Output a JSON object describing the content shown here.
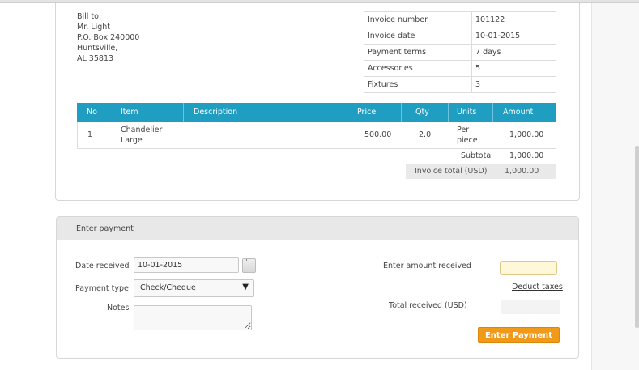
{
  "bill_to": {
    "heading": "Bill to:",
    "name": "Mr. Light",
    "address_line1": "P.O. Box 240000",
    "city": "Huntsville,",
    "state_zip": "AL 35813"
  },
  "invoice_meta": [
    {
      "label": "Invoice number",
      "value": "101122"
    },
    {
      "label": "Invoice date",
      "value": "10-01-2015"
    },
    {
      "label": "Payment terms",
      "value": "7 days"
    },
    {
      "label": "Accessories",
      "value": "5"
    },
    {
      "label": "Fixtures",
      "value": "3"
    }
  ],
  "items_table": {
    "headers": {
      "no": "No",
      "item": "Item",
      "description": "Description",
      "price": "Price",
      "qty": "Qty",
      "units": "Units",
      "amount": "Amount"
    },
    "rows": [
      {
        "no": "1",
        "item_line1": "Chandelier",
        "item_line2": "Large",
        "description": "",
        "price": "500.00",
        "qty": "2.0",
        "units_line1": "Per",
        "units_line2": "piece",
        "amount": "1,000.00"
      }
    ],
    "subtotal_label": "Subtotal",
    "subtotal_value": "1,000.00",
    "total_label": "Invoice total (USD)",
    "total_value": "1,000.00"
  },
  "payment": {
    "section_title": "Enter payment",
    "date_label": "Date received",
    "date_value": "10-01-2015",
    "type_label": "Payment type",
    "type_value": "Check/Cheque",
    "notes_label": "Notes",
    "notes_value": "",
    "amount_label": "Enter amount received",
    "amount_value": "",
    "deduct_taxes_label": "Deduct taxes",
    "total_received_label": "Total received (USD)",
    "total_received_value": "",
    "submit_label": "Enter Payment"
  },
  "icons": {
    "calendar": "calendar-icon",
    "dropdown": "chevron-down-icon"
  },
  "colors": {
    "table_header": "#1f9ec2",
    "primary_button": "#f19a1a",
    "amount_field": "#fff8d8"
  }
}
